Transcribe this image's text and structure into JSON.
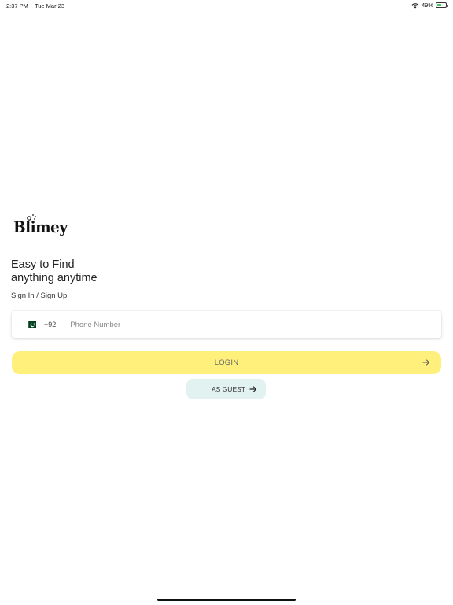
{
  "status_bar": {
    "time": "2:37 PM",
    "date": "Tue Mar 23",
    "battery_percent": "49%",
    "battery_level": 0.49,
    "icons": [
      "wifi-icon",
      "battery-icon"
    ]
  },
  "brand": {
    "logo_text": "Blimey"
  },
  "hero": {
    "line1": "Easy to Find",
    "line2": "anything anytime"
  },
  "auth": {
    "subtitle": "Sign In / Sign Up"
  },
  "phone": {
    "country_flag": "pakistan-flag-icon",
    "dial_code": "+92",
    "placeholder": "Phone Number",
    "value": ""
  },
  "buttons": {
    "login_label": "LOGIN",
    "guest_label": "AS GUEST"
  },
  "colors": {
    "login_bg": "#fff07c",
    "guest_bg": "#e1f2f0",
    "flag_green": "#01411c"
  }
}
